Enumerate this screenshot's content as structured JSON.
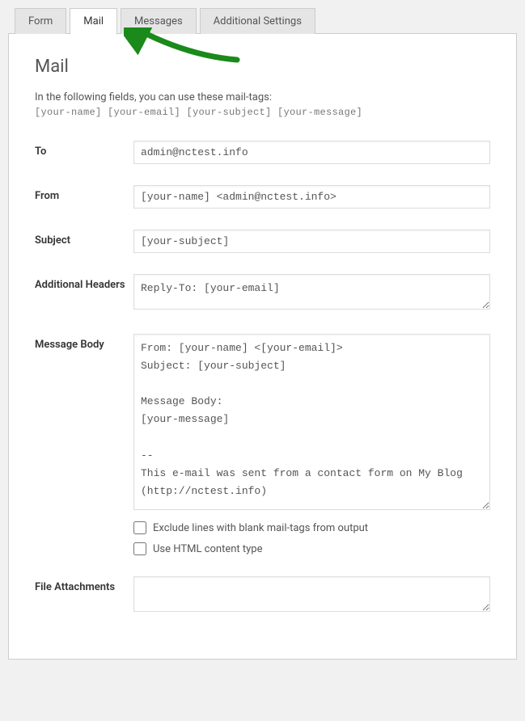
{
  "tabs": {
    "form": "Form",
    "mail": "Mail",
    "messages": "Messages",
    "additional": "Additional Settings"
  },
  "panel": {
    "title": "Mail",
    "intro": "In the following fields, you can use these mail-tags:",
    "mailTags": "[your-name] [your-email] [your-subject] [your-message]"
  },
  "fields": {
    "to": {
      "label": "To",
      "value": "admin@nctest.info"
    },
    "from": {
      "label": "From",
      "value": "[your-name] <admin@nctest.info>"
    },
    "subject": {
      "label": "Subject",
      "value": "[your-subject]"
    },
    "headers": {
      "label": "Additional Headers",
      "value": "Reply-To: [your-email]"
    },
    "body": {
      "label": "Message Body",
      "value": "From: [your-name] <[your-email]>\nSubject: [your-subject]\n\nMessage Body:\n[your-message]\n\n--\nThis e-mail was sent from a contact form on My Blog (http://nctest.info)"
    },
    "excludeBlank": {
      "label": "Exclude lines with blank mail-tags from output"
    },
    "useHtml": {
      "label": "Use HTML content type"
    },
    "attachments": {
      "label": "File Attachments",
      "value": ""
    }
  }
}
